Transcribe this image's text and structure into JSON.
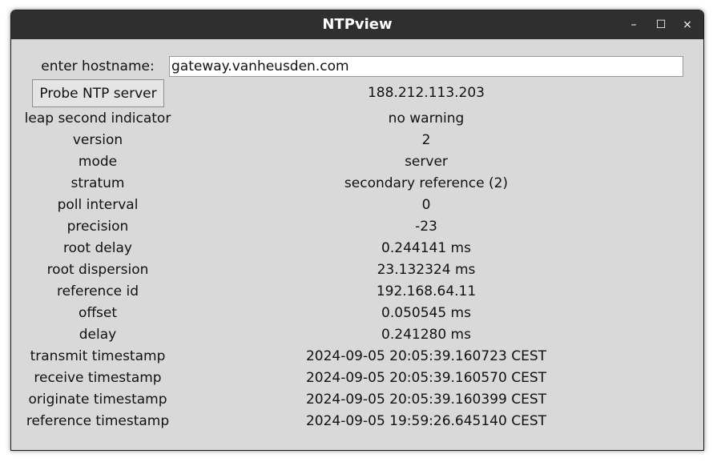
{
  "window": {
    "title": "NTPview",
    "minimize_glyph": "–",
    "maximize_glyph": "☐",
    "close_glyph": "×"
  },
  "form": {
    "hostname_label": "enter hostname:",
    "hostname_value": "gateway.vanheusden.com",
    "probe_button_label": "Probe NTP server",
    "resolved_ip": "188.212.113.203"
  },
  "fields": [
    {
      "label": "leap second indicator",
      "value": "no warning"
    },
    {
      "label": "version",
      "value": "2"
    },
    {
      "label": "mode",
      "value": "server"
    },
    {
      "label": "stratum",
      "value": "secondary reference (2)"
    },
    {
      "label": "poll interval",
      "value": "0"
    },
    {
      "label": "precision",
      "value": "-23"
    },
    {
      "label": "root delay",
      "value": "0.244141 ms"
    },
    {
      "label": "root dispersion",
      "value": "23.132324 ms"
    },
    {
      "label": "reference id",
      "value": "192.168.64.11"
    },
    {
      "label": "offset",
      "value": "0.050545 ms"
    },
    {
      "label": "delay",
      "value": "0.241280 ms"
    },
    {
      "label": "transmit timestamp",
      "value": "2024-09-05 20:05:39.160723 CEST"
    },
    {
      "label": "receive timestamp",
      "value": "2024-09-05 20:05:39.160570 CEST"
    },
    {
      "label": "originate timestamp",
      "value": "2024-09-05 20:05:39.160399 CEST"
    },
    {
      "label": "reference timestamp",
      "value": "2024-09-05 19:59:26.645140 CEST"
    }
  ]
}
